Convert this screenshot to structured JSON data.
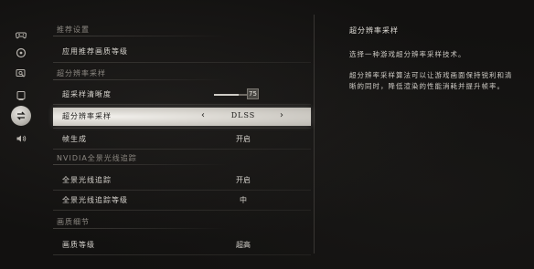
{
  "sidebar": {
    "items": [
      {
        "icon": "gamepad-icon",
        "active": false
      },
      {
        "icon": "audio-disc-icon",
        "active": false
      },
      {
        "icon": "search-display-icon",
        "active": false
      },
      {
        "icon": "monitor-icon",
        "active": false
      },
      {
        "icon": "swap-arrows-icon",
        "active": true
      },
      {
        "icon": "speaker-icon",
        "active": false
      }
    ]
  },
  "settings": {
    "section_recommended": "推荐设置",
    "apply_recommended_label": "应用推荐画质等级",
    "section_super_resolution": "超分辨率采样",
    "sharpness_label": "超采样清晰度",
    "sharpness_value": "75",
    "sharpness_level": 0.75,
    "sr_label": "超分辨率采样",
    "sr_value": "DLSS",
    "frame_gen_label": "帧生成",
    "frame_gen_value": "开启",
    "section_raytracing": "NVIDIA全景光线追踪",
    "rt_label": "全景光线追踪",
    "rt_value": "开启",
    "rt_level_label": "全景光线追踪等级",
    "rt_level_value": "中",
    "section_detail": "画质细节",
    "quality_label": "画质等级",
    "quality_value": "超高"
  },
  "description": {
    "title": "超分辨率采样",
    "line1": "选择一种游戏超分辨率采样技术。",
    "paragraph": "超分辨率采样算法可以让游戏画面保持锐利和清晰的同时，降低渲染的性能消耗并提升帧率。"
  },
  "colors": {
    "background": "#121110",
    "selected_row": "#dcd9d3",
    "text": "#d8d5cf"
  }
}
